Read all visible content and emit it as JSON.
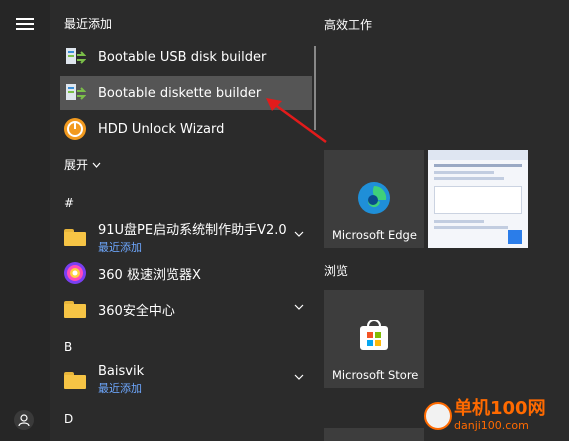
{
  "sections": {
    "recent": "最近添加",
    "expand": "展开",
    "hash": "#",
    "letter_b": "B",
    "letter_d": "D"
  },
  "recent_items": [
    {
      "label": "Bootable USB disk builder",
      "icon": "bootable-app-icon"
    },
    {
      "label": "Bootable diskette builder",
      "icon": "bootable-app-icon"
    },
    {
      "label": "HDD Unlock Wizard",
      "icon": "hdd-unlock-icon"
    }
  ],
  "hash_items": [
    {
      "label": "91U盘PE启动系统制作助手V2.0",
      "sub": "最近添加",
      "icon": "folder-icon"
    },
    {
      "label": "360 极速浏览器X",
      "icon": "browser-360-icon"
    },
    {
      "label": "360安全中心",
      "icon": "folder-icon"
    }
  ],
  "b_items": [
    {
      "label": "Baisvik",
      "sub": "最近添加",
      "icon": "folder-icon"
    }
  ],
  "tile_groups": {
    "group1": "高效工作",
    "group2": "浏览"
  },
  "tiles": {
    "edge": "Microsoft Edge",
    "store": "Microsoft Store"
  },
  "watermark": {
    "title": "单机100网",
    "url": "danji100.com"
  },
  "colors": {
    "background": "#2b2b2b",
    "hover": "#555555",
    "tile": "#3d3d3d",
    "sub_text": "#6ea8ff",
    "arrow": "#e21b1b",
    "watermark": "#ff6a00"
  }
}
